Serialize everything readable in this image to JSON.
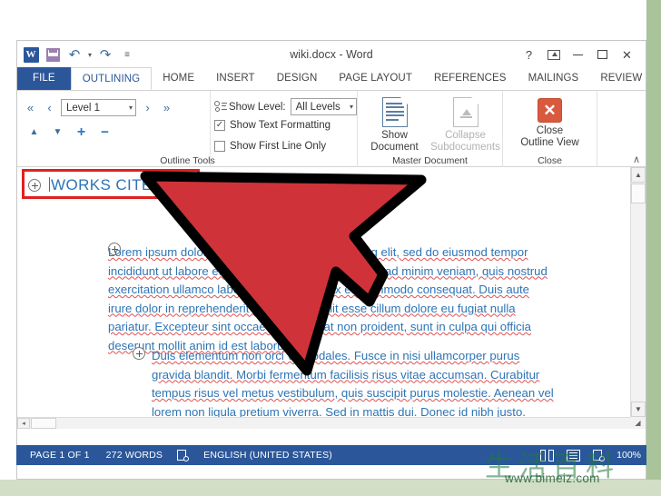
{
  "window": {
    "title": "wiki.docx - Word",
    "quick_access": [
      {
        "name": "word-logo",
        "glyph": "W"
      },
      {
        "name": "save-icon",
        "label": "Save"
      },
      {
        "name": "undo-icon",
        "glyph": "↶"
      },
      {
        "name": "undo-dropdown",
        "glyph": "▾"
      },
      {
        "name": "redo-icon",
        "glyph": "↷"
      },
      {
        "name": "customize-qat-icon",
        "glyph": "≡"
      }
    ],
    "buttons": {
      "help": "?",
      "ribbon_display_options": "⤴",
      "minimize": "—",
      "restore": "❐",
      "close": "✕"
    }
  },
  "tabs": {
    "file": "FILE",
    "items": [
      {
        "label": "OUTLINING",
        "active": true
      },
      {
        "label": "HOME",
        "active": false
      },
      {
        "label": "INSERT",
        "active": false
      },
      {
        "label": "DESIGN",
        "active": false
      },
      {
        "label": "PAGE LAYOUT",
        "active": false
      },
      {
        "label": "REFERENCES",
        "active": false
      },
      {
        "label": "MAILINGS",
        "active": false
      },
      {
        "label": "REVIEW",
        "active": false
      }
    ],
    "overflow": "▸"
  },
  "ribbon": {
    "outline_tools": {
      "group_label": "Outline Tools",
      "promote_to_heading1": "«",
      "promote": "‹",
      "level_value": "Level 1",
      "level_caret": "▾",
      "demote": "›",
      "demote_to_body": "»",
      "move_up": "▲",
      "move_down": "▼",
      "expand": "+",
      "collapse": "−",
      "show_level_label": "Show Level:",
      "show_level_value": "All Levels",
      "show_level_caret": "▾",
      "show_text_formatting": "Show Text Formatting",
      "show_text_formatting_checked": "✓",
      "show_first_line_only": "Show First Line Only"
    },
    "master_document": {
      "group_label": "Master Document",
      "show_document_line1": "Show",
      "show_document_line2": "Document",
      "collapse_sub_line1": "Collapse",
      "collapse_sub_line2": "Subdocuments"
    },
    "close": {
      "group_label": "Close",
      "close_line1": "Close",
      "close_line2": "Outline View",
      "x_glyph": "✕"
    },
    "collapse_ribbon": "∧"
  },
  "document": {
    "heading": "WORKS CITED",
    "paragraph1": "Lorem ipsum dolor sit amet, consectetur adipiscing elit, sed do eiusmod tempor incididunt ut labore et dolore magna aliqua. Ut enim ad minim veniam, quis nostrud exercitation ullamco laboris nisi ut aliquip ex ea commodo consequat. Duis aute irure dolor in reprehenderit in voluptate velit esse cillum dolore eu fugiat nulla pariatur. Excepteur sint occaecat cupidatat non proident, sunt in culpa qui officia deserunt mollit anim id est laborum.\".",
    "paragraph2": "Duis elementum non orci vel sodales. Fusce in nisi ullamcorper purus gravida blandit. Morbi fermentum facilisis risus vitae accumsan. Curabitur tempus risus vel metus vestibulum, quis suscipit purus molestie. Aenean vel lorem non ligula pretium viverra. Sed in mattis dui. Donec id nibh justo. Praesent accumsan rhoncus magna sit amet fermentum. Nunc a enim convallis, vestibulum libero id, imperdiet"
  },
  "scrollbars": {
    "v_up": "▲",
    "v_down": "▼",
    "h_left": "◂",
    "corner": "◢"
  },
  "status_bar": {
    "page": "PAGE 1 OF 1",
    "words": "272 WORDS",
    "proofing_icon": "proofing-errors-icon",
    "language": "ENGLISH (UNITED STATES)",
    "views": [
      "read-mode-icon",
      "print-layout-icon",
      "web-layout-icon"
    ],
    "zoom": "100%"
  },
  "watermark": {
    "characters": "生活百科",
    "url": "www.bimeiz.com"
  },
  "colors": {
    "word_blue": "#2b579a",
    "heading_blue": "#2e74b5",
    "highlight_red": "#e02020",
    "cursor_red": "#cf3339",
    "close_orange": "#d9593f"
  }
}
